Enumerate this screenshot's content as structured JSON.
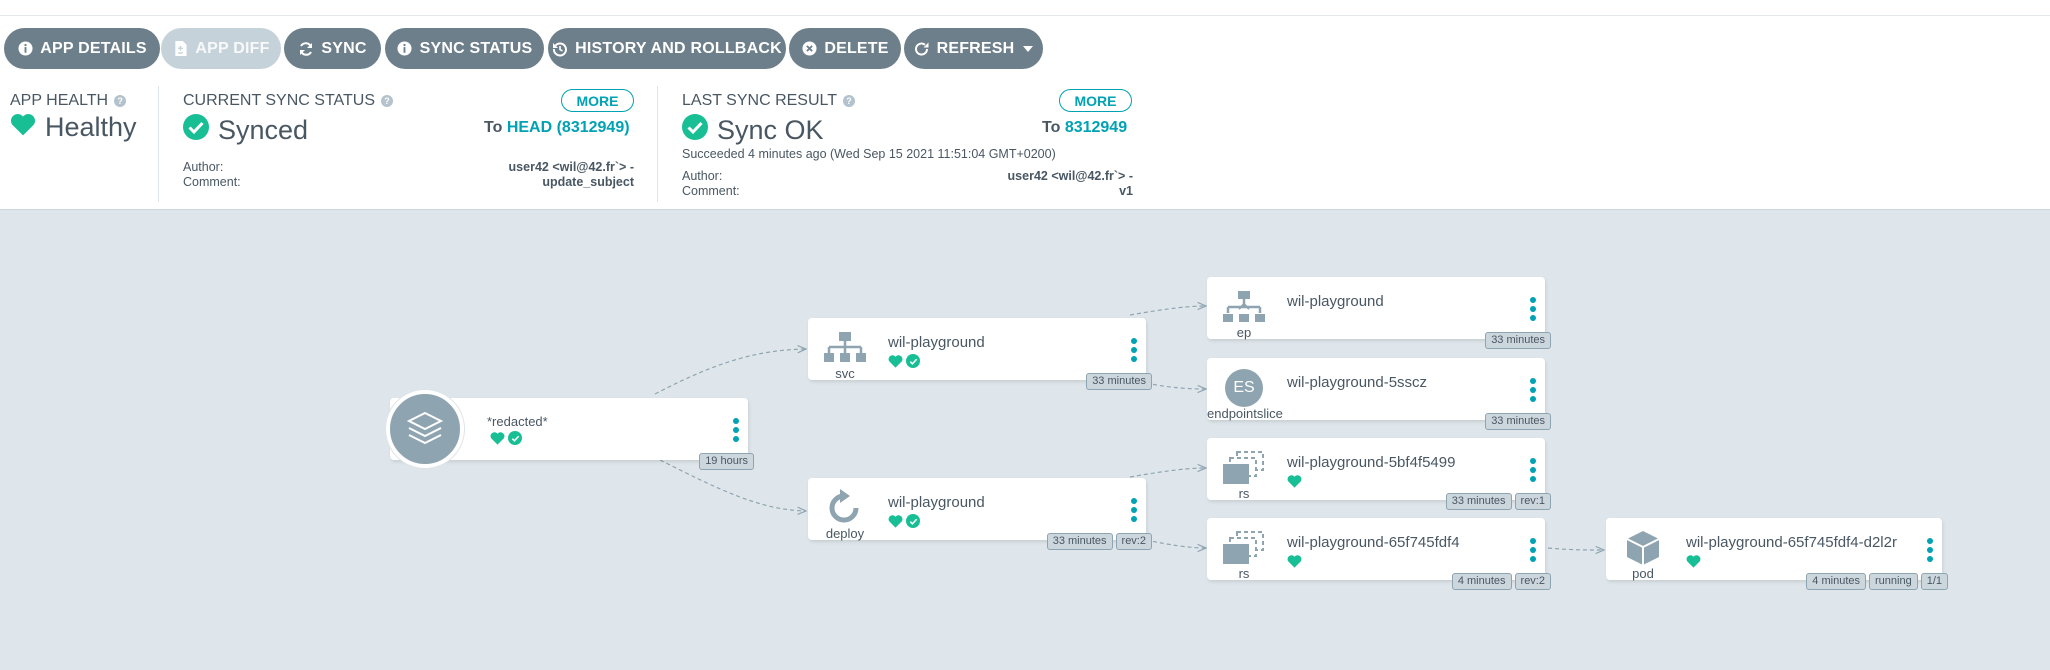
{
  "toolbar": {
    "buttons": [
      {
        "label": "APP DETAILS",
        "icon": "info-circle-icon"
      },
      {
        "label": "APP DIFF",
        "icon": "file-diff-icon",
        "disabled": true
      },
      {
        "label": "SYNC",
        "icon": "sync-icon"
      },
      {
        "label": "SYNC STATUS",
        "icon": "info-circle-icon"
      },
      {
        "label": "HISTORY AND ROLLBACK",
        "icon": "history-icon"
      },
      {
        "label": "DELETE",
        "icon": "times-circle-icon"
      },
      {
        "label": "REFRESH",
        "icon": "redo-icon",
        "dropdown": true
      }
    ]
  },
  "health": {
    "title": "APP HEALTH",
    "status": "Healthy"
  },
  "sync_status": {
    "title": "CURRENT SYNC STATUS",
    "status": "Synced",
    "more": "MORE",
    "to_prefix": "To",
    "to_rev": "HEAD (8312949)",
    "author_label": "Author:",
    "author": "user42 <wil@42.fr`> -",
    "comment_label": "Comment:",
    "comment": "update_subject"
  },
  "last_sync": {
    "title": "LAST SYNC RESULT",
    "status": "Sync OK",
    "more": "MORE",
    "to_prefix": "To",
    "to_rev": "8312949",
    "succeeded": "Succeeded 4 minutes ago (Wed Sep 15 2021 11:51:04 GMT+0200)",
    "author_label": "Author:",
    "author": "user42 <wil@42.fr`> -",
    "comment_label": "Comment:",
    "comment": "v1"
  },
  "tree": {
    "app": {
      "name": "*redacted*",
      "age": "19 hours"
    },
    "nodes": [
      {
        "id": "svc",
        "kind": "svc",
        "name": "wil-playground",
        "tags": [
          "33 minutes"
        ],
        "healthy": true,
        "synced": true
      },
      {
        "id": "deploy",
        "kind": "deploy",
        "name": "wil-playground",
        "tags": [
          "33 minutes",
          "rev:2"
        ],
        "healthy": true,
        "synced": true
      },
      {
        "id": "ep",
        "kind": "ep",
        "name": "wil-playground",
        "tags": [
          "33 minutes"
        ],
        "healthy": false,
        "synced": false
      },
      {
        "id": "es",
        "kind": "endpointslice",
        "icon_text": "ES",
        "name": "wil-playground-5sscz",
        "tags": [
          "33 minutes"
        ],
        "healthy": false,
        "synced": false
      },
      {
        "id": "rs1",
        "kind": "rs",
        "name": "wil-playground-5bf4f5499",
        "tags": [
          "33 minutes",
          "rev:1"
        ],
        "healthy": true,
        "synced": false
      },
      {
        "id": "rs2",
        "kind": "rs",
        "name": "wil-playground-65f745fdf4",
        "tags": [
          "4 minutes",
          "rev:2"
        ],
        "healthy": true,
        "synced": false
      },
      {
        "id": "pod",
        "kind": "pod",
        "name": "wil-playground-65f745fdf4-d2l2r",
        "tags": [
          "4 minutes",
          "running",
          "1/1"
        ],
        "healthy": true,
        "synced": false
      }
    ]
  },
  "colors": {
    "accent": "#00a2b3",
    "healthy": "#18be94",
    "button": "#6d7f8b",
    "canvas": "#dee6eb"
  }
}
